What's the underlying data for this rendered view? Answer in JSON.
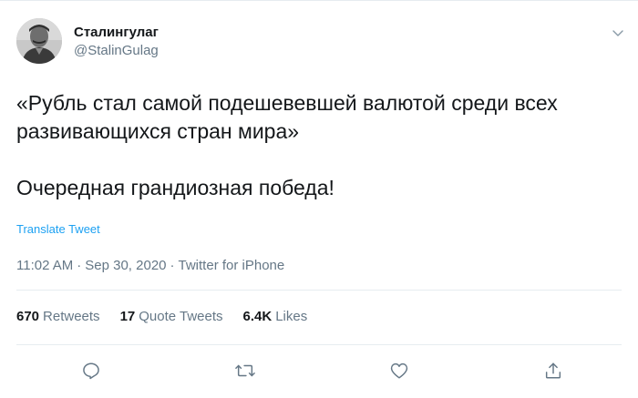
{
  "user": {
    "display_name": "Сталингулаг",
    "handle": "@StalinGulag",
    "avatar_icon": "avatar-portrait"
  },
  "tweet": {
    "paragraph_1": "«Рубль стал самой подешевевшей валютой среди всех развивающихся стран мира»",
    "paragraph_2": "Очередная грандиозная победа!",
    "translate_label": "Translate Tweet"
  },
  "meta": {
    "time": "11:02 AM",
    "date": "Sep 30, 2020",
    "source": "Twitter for iPhone",
    "separator": "·"
  },
  "stats": {
    "retweets_count": "670",
    "retweets_label": "Retweets",
    "quotes_count": "17",
    "quotes_label": "Quote Tweets",
    "likes_count": "6.4K",
    "likes_label": "Likes"
  },
  "icons": {
    "caret": "chevron-down-icon",
    "reply": "reply-icon",
    "retweet": "retweet-icon",
    "like": "heart-icon",
    "share": "share-icon"
  },
  "colors": {
    "text_primary": "#14171a",
    "text_secondary": "#657786",
    "link": "#1da1f2",
    "divider": "#e6ecf0"
  }
}
